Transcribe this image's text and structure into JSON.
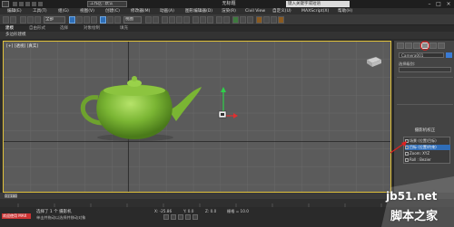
{
  "app": {
    "window_title": "无标题",
    "workspace": "工作区: 默认",
    "search_placeholder": "键入关键字或短语"
  },
  "menu": {
    "items": [
      "编辑(E)",
      "工具(T)",
      "组(G)",
      "视图(V)",
      "创建(C)",
      "修改器(M)",
      "动画(A)",
      "图形编辑器(D)",
      "渲染(R)",
      "Civil View",
      "自定义(U)",
      "MAXScript(X)",
      "帮助(H)"
    ]
  },
  "toolbar": {
    "selection_filter": "全部",
    "ref_coord": "视图"
  },
  "ribbon": {
    "tabs": [
      "建模",
      "自由形式",
      "选择",
      "对象绘制",
      "填充"
    ]
  },
  "subbar": {
    "label": "多边形建模"
  },
  "viewport": {
    "label": "[+] [透视] [真实]"
  },
  "command_panel": {
    "object_name": "Camera001",
    "selection_label": "选择级别:",
    "heading": "摄影机校正",
    "list": [
      {
        "label": "场景 (位置/目标)",
        "selected": false
      },
      {
        "label": "目标 (位置/约束)",
        "selected": true
      },
      {
        "label": "Zoom: XYZ",
        "selected": false
      },
      {
        "label": "Roll : Bezier",
        "selected": false
      }
    ]
  },
  "timeline": {
    "slider_label": "0 / 100"
  },
  "status": {
    "line1": "选择了 1 个 摄影机",
    "line2": "单击并拖动以选择并移动对象",
    "welcome": "欢迎使用 MAX",
    "x": "X: -25.86",
    "y": "Y: 0.0",
    "z": "Z: 0.0",
    "grid": "栅格 = 10.0"
  },
  "watermark": {
    "domain": "jb51.net",
    "name": "脚本之家"
  },
  "colors": {
    "teapot": "#7ab533",
    "viewport_bg": "#5b5b5b",
    "active_border": "#e0c13a",
    "accent": "#2e6fb8"
  }
}
